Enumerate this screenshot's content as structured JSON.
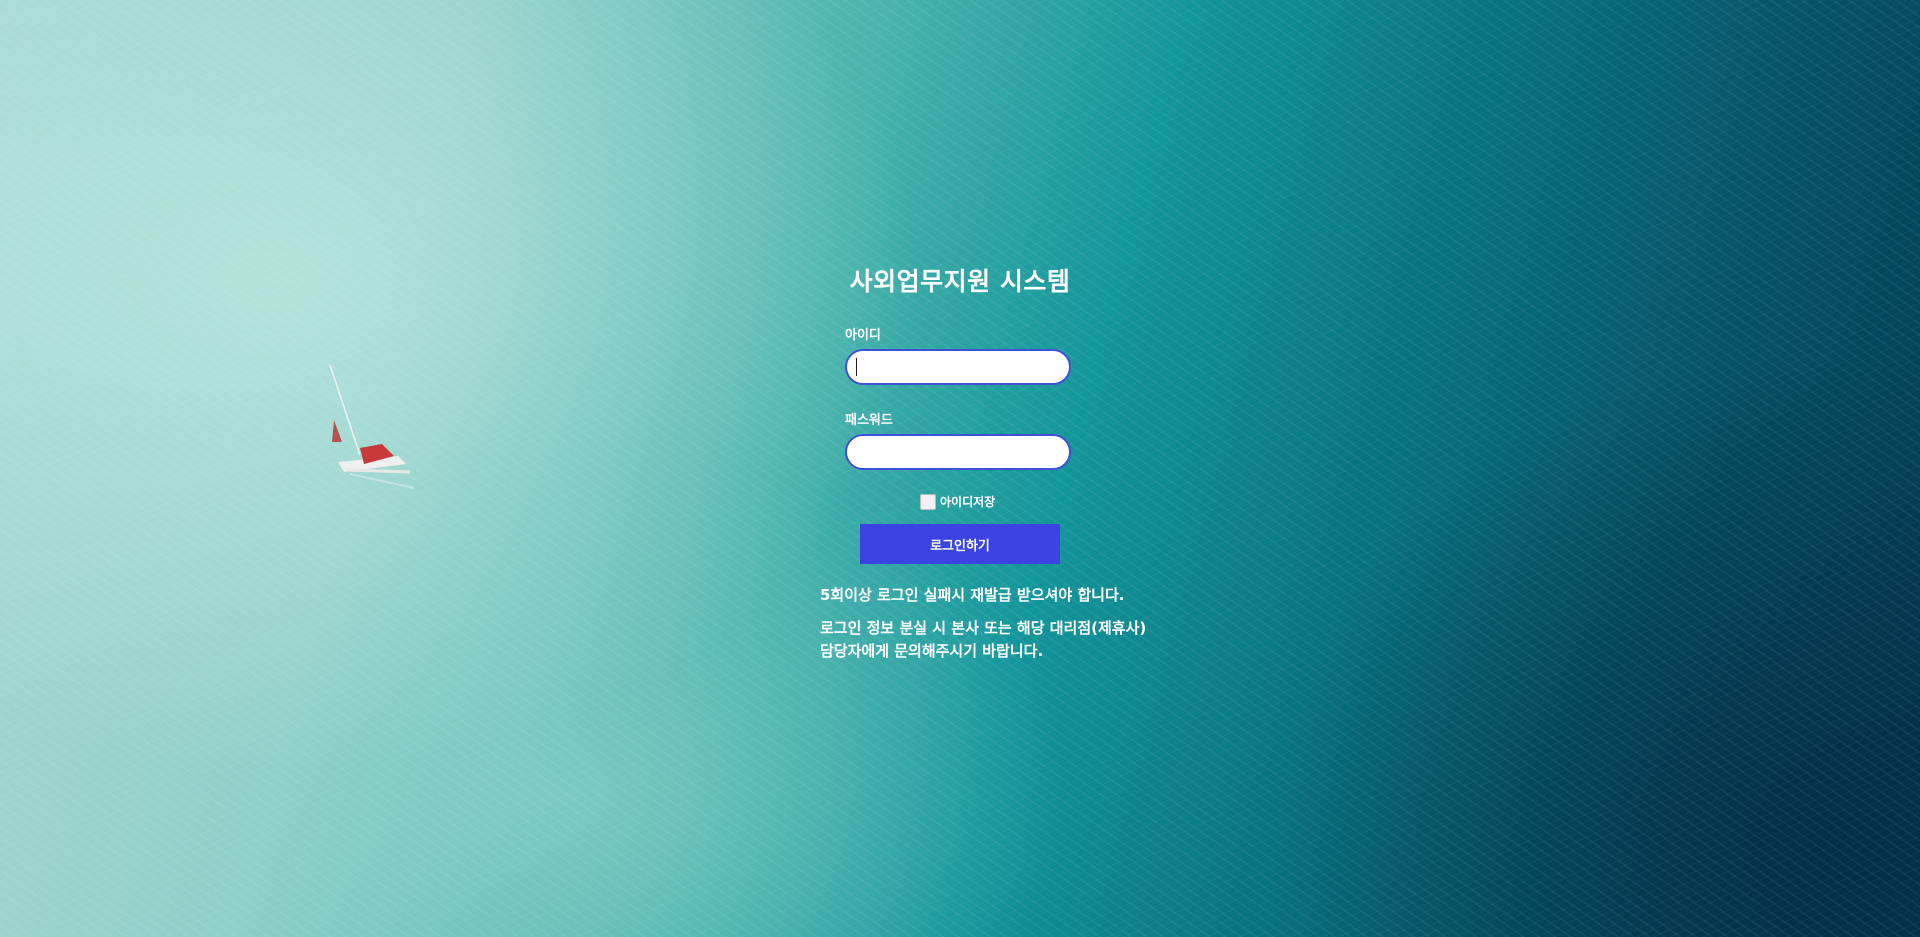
{
  "page": {
    "title": "사외업무지원 시스템"
  },
  "form": {
    "id_label": "아이디",
    "id_value": "",
    "password_label": "패스워드",
    "password_value": "",
    "remember_label": "아이디저장",
    "remember_checked": false,
    "login_button": "로그인하기"
  },
  "notices": [
    "5회이상 로그인 실패시 재발급 받으셔야 합니다.",
    "로그인 정보 분실 시 본사 또는 해당 대리점(제휴사) 담당자에게 문의해주시기 바랍니다."
  ],
  "colors": {
    "button": "#3b43e2",
    "input_border": "#3f4fd6",
    "text": "#ffffff"
  }
}
